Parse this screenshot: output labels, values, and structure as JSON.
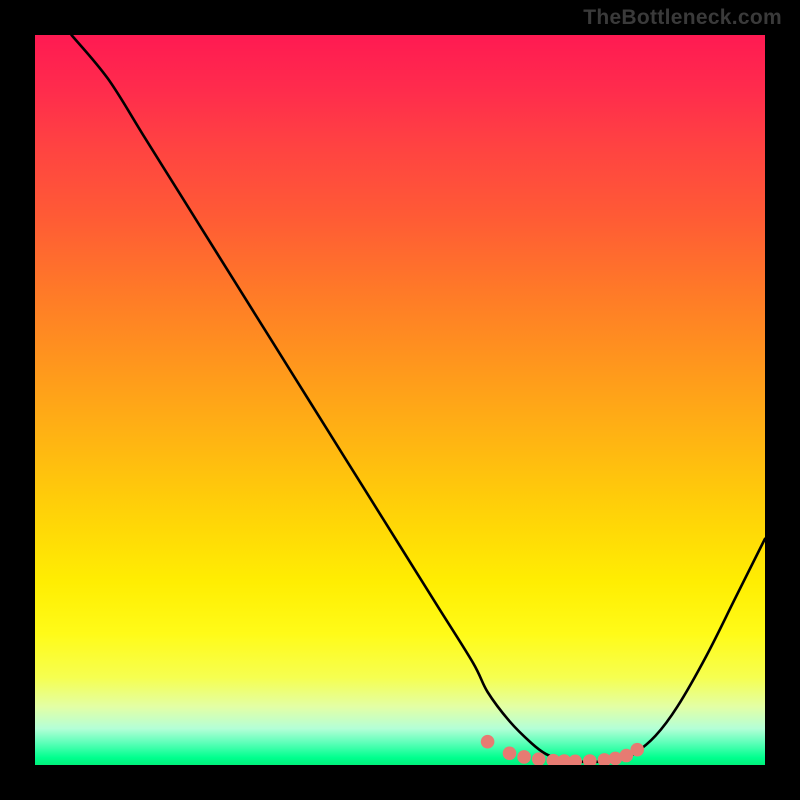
{
  "watermark": "TheBottleneck.com",
  "chart_data": {
    "type": "line",
    "title": "",
    "xlabel": "",
    "ylabel": "",
    "xlim": [
      0,
      100
    ],
    "ylim": [
      0,
      100
    ],
    "grid": false,
    "legend": false,
    "series": [
      {
        "name": "bottleneck-curve",
        "color": "#000000",
        "x": [
          5,
          10,
          15,
          20,
          25,
          30,
          35,
          40,
          45,
          50,
          55,
          60,
          62,
          65,
          68,
          70,
          72,
          74,
          76,
          78,
          80,
          82,
          85,
          88,
          92,
          96,
          100
        ],
        "y": [
          100,
          94,
          86,
          78,
          70,
          62,
          54,
          46,
          38,
          30,
          22,
          14,
          10,
          6,
          3,
          1.5,
          0.8,
          0.5,
          0.4,
          0.5,
          0.8,
          1.5,
          4,
          8,
          15,
          23,
          31
        ]
      }
    ],
    "markers": {
      "name": "highlight-dots",
      "color": "#e77b72",
      "x": [
        62,
        65,
        67,
        69,
        71,
        72.5,
        74,
        76,
        78,
        79.5,
        81,
        82.5
      ],
      "y": [
        3.2,
        1.6,
        1.1,
        0.8,
        0.6,
        0.55,
        0.5,
        0.55,
        0.7,
        0.9,
        1.3,
        2.1
      ]
    }
  }
}
